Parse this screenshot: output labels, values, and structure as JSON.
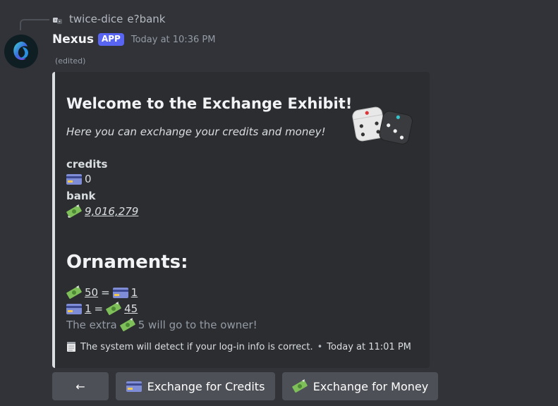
{
  "reply": {
    "username": "twice-dice",
    "content": "e?bank"
  },
  "author": {
    "name": "Nexus",
    "badge": "APP",
    "timestamp": "Today at 10:36 PM",
    "edited": "(edited)"
  },
  "embed": {
    "accent_color": "#dbdee1",
    "title": "Welcome to the Exchange Exhibit!",
    "description": "Here you can exchange your credits and money!",
    "thumbnail_icon": "dice-icon",
    "fields": {
      "credits": {
        "name": "credits",
        "value": "0",
        "icon": "credit-card-icon"
      },
      "bank": {
        "name": "bank",
        "value": "9,016,279",
        "icon": "money-icon"
      }
    },
    "ornaments": {
      "title": "Ornaments:",
      "rate1": {
        "left": "50",
        "eq": "=",
        "right": "1"
      },
      "rate2": {
        "left": "1",
        "eq": "=",
        "right": "45"
      },
      "note_prefix": "The extra",
      "note_suffix": "5 will go to the owner!"
    },
    "footer": {
      "icon": "notepad-icon",
      "text": "The system will detect if your log-in info is correct.",
      "separator": "•",
      "time": "Today at 11:01 PM"
    }
  },
  "buttons": {
    "back": "←",
    "credits": "Exchange for Credits",
    "money": "Exchange for Money"
  }
}
